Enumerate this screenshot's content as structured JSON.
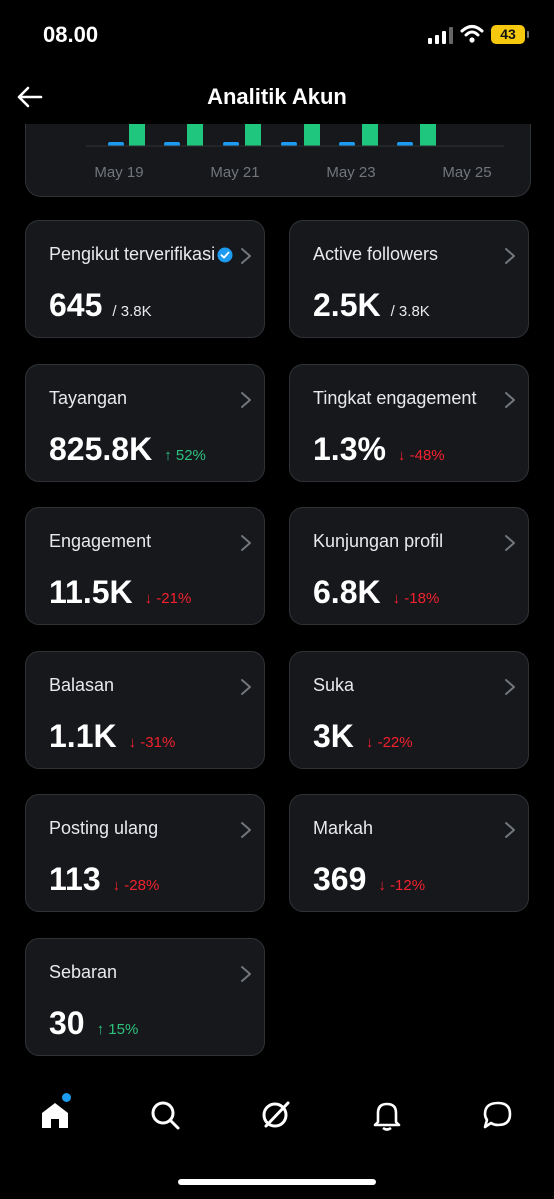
{
  "status": {
    "time": "08.00",
    "battery": "43"
  },
  "header": {
    "title": "Analitik Akun"
  },
  "chart_data": {
    "type": "bar",
    "x_tick_labels": [
      "May 19",
      "May 21",
      "May 23",
      "May 25"
    ],
    "series_colors": [
      "#1d9bf0",
      "#1fc67d"
    ],
    "note_visible_portion": "cropped top of bar chart"
  },
  "metrics": [
    {
      "label": "Pengikut terverifikasi",
      "value": "645",
      "sub": "/ 3.8K",
      "verified": true
    },
    {
      "label": "Active followers",
      "value": "2.5K",
      "sub": "/ 3.8K"
    },
    {
      "label": "Tayangan",
      "value": "825.8K",
      "change": "↑ 52%",
      "dir": "up"
    },
    {
      "label": "Tingkat engagement",
      "value": "1.3%",
      "change": "↓ -48%",
      "dir": "down"
    },
    {
      "label": "Engagement",
      "value": "11.5K",
      "change": "↓ -21%",
      "dir": "down"
    },
    {
      "label": "Kunjungan profil",
      "value": "6.8K",
      "change": "↓ -18%",
      "dir": "down"
    },
    {
      "label": "Balasan",
      "value": "1.1K",
      "change": "↓ -31%",
      "dir": "down"
    },
    {
      "label": "Suka",
      "value": "3K",
      "change": "↓ -22%",
      "dir": "down"
    },
    {
      "label": "Posting ulang",
      "value": "113",
      "change": "↓ -28%",
      "dir": "down"
    },
    {
      "label": "Markah",
      "value": "369",
      "change": "↓ -12%",
      "dir": "down"
    },
    {
      "label": "Sebaran",
      "value": "30",
      "change": "↑ 15%",
      "dir": "up"
    }
  ],
  "colors": {
    "up": "#2ec27e",
    "down": "#f4212e",
    "accent": "#1d9bf0",
    "bar_green": "#1fc67d"
  },
  "tabs": [
    "home-icon",
    "search-icon",
    "grok-icon",
    "bell-icon",
    "messages-icon"
  ]
}
